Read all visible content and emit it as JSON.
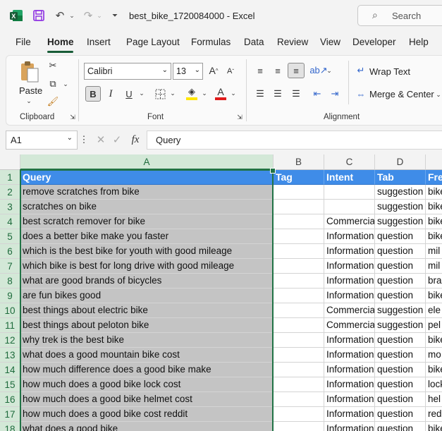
{
  "window": {
    "title": "best_bike_1720084000  -  Excel",
    "search_placeholder": "Search"
  },
  "menu": {
    "tabs": [
      "File",
      "Home",
      "Insert",
      "Page Layout",
      "Formulas",
      "Data",
      "Review",
      "View",
      "Developer",
      "Help"
    ],
    "active": "Home"
  },
  "ribbon": {
    "clipboard": {
      "label": "Clipboard",
      "paste": "Paste"
    },
    "font": {
      "label": "Font",
      "family": "Calibri",
      "size": "13"
    },
    "alignment": {
      "label": "Alignment",
      "wrap_text": "Wrap Text",
      "merge_center": "Merge & Center"
    }
  },
  "formula_bar": {
    "name_box": "A1",
    "fx": "fx",
    "content": "Query"
  },
  "grid": {
    "columns": [
      "A",
      "B",
      "C",
      "D"
    ],
    "rows": [
      [
        "Query",
        "Tag",
        "Intent",
        "Tab",
        "Fre"
      ],
      [
        "remove scratches from bike",
        "",
        "",
        "suggestion",
        "bike"
      ],
      [
        "scratches on bike",
        "",
        "",
        "suggestion",
        "bike"
      ],
      [
        "best scratch remover for bike",
        "",
        "Commercial",
        "suggestion",
        "bike"
      ],
      [
        "does a better bike make you faster",
        "",
        "Informational",
        "question",
        "bike"
      ],
      [
        "which is the best bike for youth with good mileage",
        "",
        "Informational",
        "question",
        "mil"
      ],
      [
        "which bike is best for long drive with good mileage",
        "",
        "Informational",
        "question",
        "mil"
      ],
      [
        "what are good brands of bicycles",
        "",
        "Informational",
        "question",
        "bra"
      ],
      [
        "are fun bikes good",
        "",
        "Informational",
        "question",
        "bike"
      ],
      [
        "best things about electric bike",
        "",
        "Commercial",
        "suggestion",
        "ele"
      ],
      [
        "best things about peloton bike",
        "",
        "Commercial",
        "suggestion",
        "pel"
      ],
      [
        "why trek is the best bike",
        "",
        "Informational",
        "question",
        "bike"
      ],
      [
        "what does a good mountain bike cost",
        "",
        "Informational",
        "question",
        "mo"
      ],
      [
        "how much difference does a good bike make",
        "",
        "Informational",
        "question",
        "bike"
      ],
      [
        "how much does a good bike lock cost",
        "",
        "Informational",
        "question",
        "lock"
      ],
      [
        "how much does a good bike helmet cost",
        "",
        "Informational",
        "question",
        "hel"
      ],
      [
        "how much does a good bike cost reddit",
        "",
        "Informational",
        "question",
        "red"
      ],
      [
        "what does a good bike",
        "",
        "Informational",
        "question",
        "bike"
      ]
    ]
  }
}
